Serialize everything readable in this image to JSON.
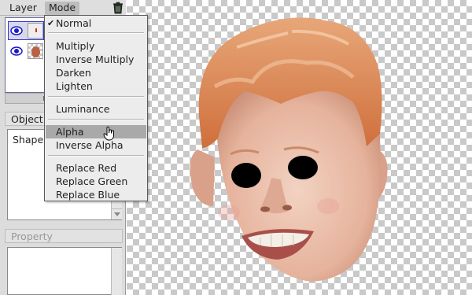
{
  "menubar": {
    "layer_label": "Layer",
    "mode_label": "Mode"
  },
  "panels": {
    "object_header": "Object",
    "object_items": [
      "Shape"
    ],
    "property_header": "Property"
  },
  "mode_menu": {
    "items": [
      {
        "label": "Normal",
        "checked": true
      },
      {
        "label": "Multiply"
      },
      {
        "label": "Inverse Multiply"
      },
      {
        "label": "Darken"
      },
      {
        "label": "Lighten"
      },
      {
        "label": "Luminance"
      },
      {
        "label": "Alpha",
        "highlighted": true
      },
      {
        "label": "Inverse Alpha"
      },
      {
        "label": "Replace Red"
      },
      {
        "label": "Replace Green"
      },
      {
        "label": "Replace Blue"
      }
    ],
    "checkmark": "✔"
  },
  "icons": [
    "eye-icon",
    "trash-icon",
    "hand-cursor-icon"
  ],
  "colors": {
    "highlight": "#a9a9a9",
    "selection_border": "#3333cc",
    "eye": "#1a1acc"
  }
}
